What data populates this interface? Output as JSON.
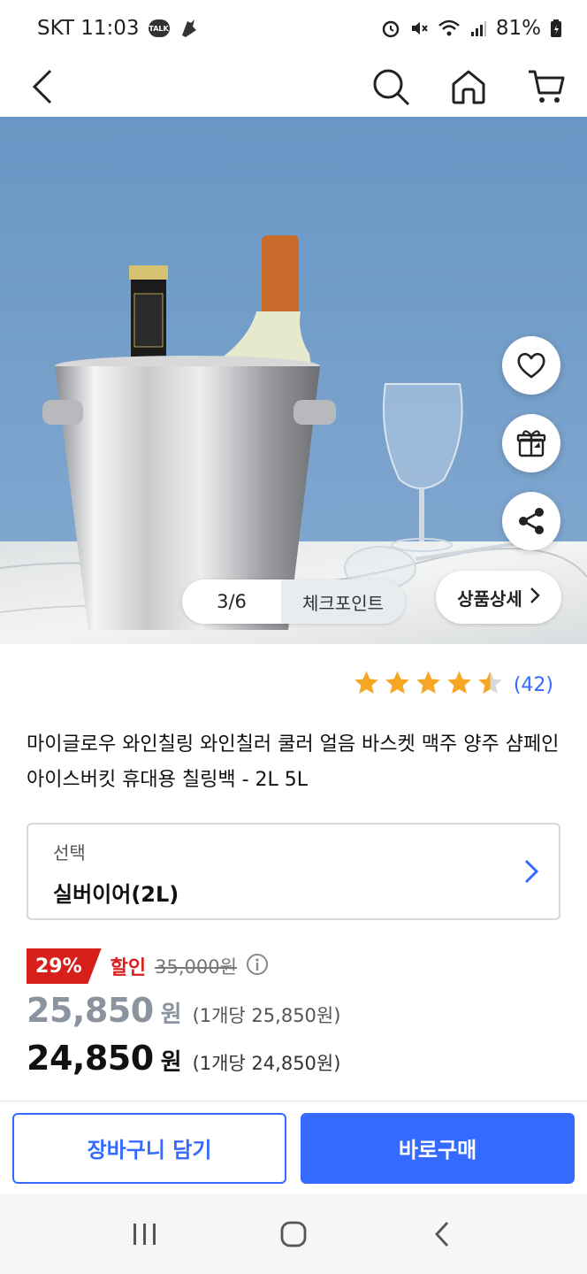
{
  "status_bar": {
    "carrier_time": "SKT 11:03",
    "talk_badge": "TALK",
    "battery": "81%"
  },
  "header": {
    "icons": [
      "back-arrow-icon",
      "search-icon",
      "home-icon",
      "cart-icon"
    ]
  },
  "hero": {
    "pager": "3/6",
    "checkpoint_label": "체크포인트",
    "detail_label": "상품상세"
  },
  "rating": {
    "stars": 4.5,
    "max": 5,
    "count_text": "(42)",
    "color": "#f5a623"
  },
  "product": {
    "title": "마이글로우 와인칠링 와인칠러 쿨러 얼음 바스켓 맥주 양주 샴페인 아이스버킷 휴대용 칠링백 - 2L 5L"
  },
  "option": {
    "label": "선택",
    "value": "실버이어(2L)"
  },
  "pricing": {
    "discount_badge": "29%",
    "discount_label": "할인",
    "original_price": "35,000원",
    "price1": "25,850",
    "price1_unit": "원",
    "price1_per": "(1개당 25,850원)",
    "price2": "24,850",
    "price2_unit": "원",
    "price2_per": "(1개당 24,850원)"
  },
  "actions": {
    "add_to_cart": "장바구니 담기",
    "buy_now": "바로구매"
  },
  "colors": {
    "accent": "#346aff",
    "discount": "#d7201c"
  }
}
